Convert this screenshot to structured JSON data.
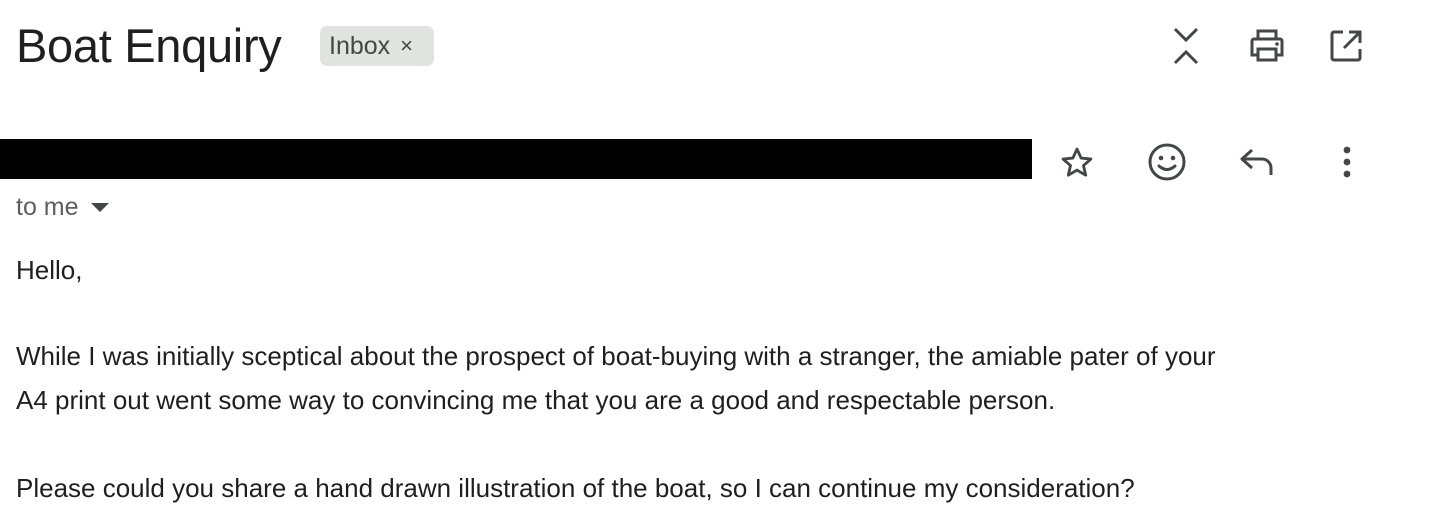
{
  "subject": "Boat Enquiry",
  "label": {
    "name": "Inbox",
    "close_symbol": "×"
  },
  "header_icons": [
    "expand-collapse-icon",
    "print-icon",
    "open-in-new-window-icon"
  ],
  "message_icons": [
    "star-icon",
    "emoji-reaction-icon",
    "reply-icon",
    "more-options-icon"
  ],
  "recipient": {
    "text": "to me"
  },
  "message": {
    "greeting": "Hello,",
    "paragraph1_line1": "While I was initially sceptical about the prospect of boat-buying with a stranger, the amiable pater of your",
    "paragraph1_line2": "A4 print out went some way to convincing me that you are a good and respectable person.",
    "paragraph2": "Please could you share a hand drawn illustration of the boat, so I can continue my consideration?"
  },
  "colors": {
    "text": "#1f1f1f",
    "icon": "#444746",
    "chip_bg": "#e1e3e1",
    "redaction": "#000000"
  }
}
